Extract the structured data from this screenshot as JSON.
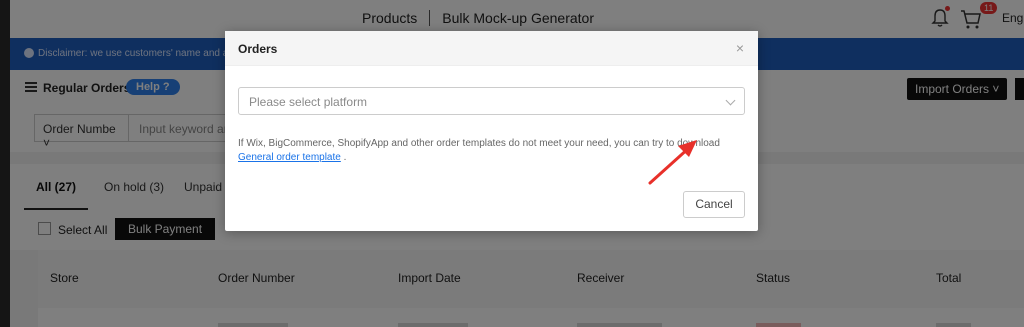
{
  "topbar": {
    "nav_products": "Products",
    "nav_bulk_mockup": "Bulk Mock-up Generator",
    "cart_count": "11",
    "language": "Engli"
  },
  "disclaimer": {
    "text": "Disclaimer: we use customers' name and addre"
  },
  "orders_header": {
    "title": "Regular Orders",
    "help_label": "Help",
    "import_label": "Import Orders"
  },
  "filter": {
    "field_select": "Order Numbe",
    "keyword_placeholder": "Input keyword and"
  },
  "tabs": [
    {
      "label": "All (27)"
    },
    {
      "label": "On hold (3)"
    },
    {
      "label": "Unpaid ("
    }
  ],
  "actions": {
    "select_all": "Select All",
    "bulk_payment": "Bulk Payment"
  },
  "table": {
    "columns": [
      "Store",
      "Order Number",
      "Import Date",
      "Receiver",
      "Status",
      "Total"
    ]
  },
  "modal": {
    "title": "Orders",
    "close_symbol": "×",
    "platform_placeholder": "Please select platform",
    "note_text": "If Wix, BigCommerce, ShopifyApp and other order templates do not meet your need, you can try to download ",
    "note_link": "General order template",
    "note_end": " .",
    "cancel_label": "Cancel"
  },
  "colors": {
    "accent_blue": "#1f5fbf",
    "link_blue": "#1a73e8",
    "arrow_red": "#e8302a"
  }
}
